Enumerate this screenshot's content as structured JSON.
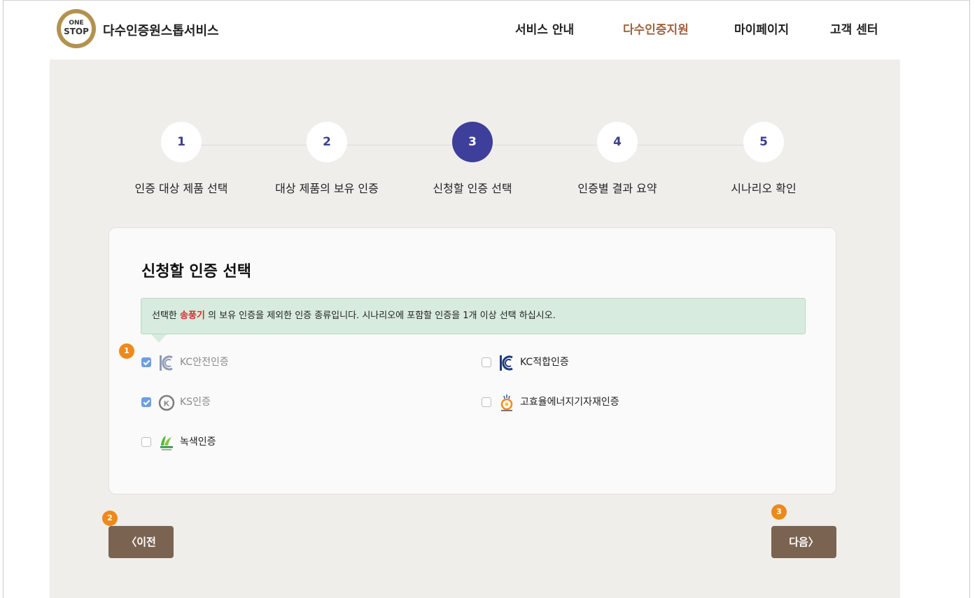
{
  "header": {
    "logo": {
      "line1": "ONE",
      "line2": "STOP"
    },
    "title": "다수인증원스톱서비스",
    "nav": [
      {
        "label": "서비스 안내"
      },
      {
        "label": "다수인증지원",
        "active": true
      },
      {
        "label": "마이페이지"
      },
      {
        "label": "고객 센터"
      }
    ]
  },
  "steps": [
    {
      "number": "1",
      "label": "인증 대상 제품 선택"
    },
    {
      "number": "2",
      "label": "대상 제품의 보유 인증"
    },
    {
      "number": "3",
      "label": "신청할 인증 선택",
      "active": true
    },
    {
      "number": "4",
      "label": "인증별 결과 요약"
    },
    {
      "number": "5",
      "label": "시나리오 확인"
    }
  ],
  "card": {
    "title": "신청할 인증 선택",
    "notice": {
      "prefix": "선택한 ",
      "product": "송풍기",
      "suffix": " 의 보유 인증을 제외한 인증 종류입니다. 시나리오에 포함할 인증을 1개 이상 선택 하십시오."
    },
    "options": [
      {
        "label": "KC안전인증",
        "checked": true,
        "disabled": true,
        "icon": "kc-mark-icon"
      },
      {
        "label": "KC적합인증",
        "checked": false,
        "disabled": false,
        "icon": "kc-mark-icon"
      },
      {
        "label": "KS인증",
        "checked": true,
        "disabled": true,
        "icon": "ks-mark-icon"
      },
      {
        "label": "고효율에너지기자재인증",
        "checked": false,
        "disabled": false,
        "icon": "high-efficiency-energy-mark-icon"
      },
      {
        "label": "녹색인증",
        "checked": false,
        "disabled": false,
        "icon": "green-certification-mark-icon"
      }
    ]
  },
  "buttons": {
    "prev": {
      "arrow": "〈",
      "label": "이전"
    },
    "next": {
      "label": "다음",
      "arrow": "〉"
    }
  },
  "markers": [
    "1",
    "2",
    "3"
  ],
  "colors": {
    "accent_nav": "#a0633d",
    "step_active": "#3d3f9a",
    "button": "#7b6352",
    "marker": "#ec8a1e",
    "highlight": "#d42b2b",
    "notice_bg": "#d8ebdf"
  }
}
